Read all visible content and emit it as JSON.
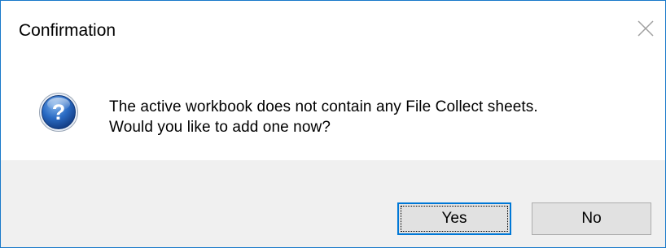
{
  "dialog": {
    "title": "Confirmation",
    "close_icon": "close-icon"
  },
  "content": {
    "icon": "question-icon",
    "message_line1": "The active workbook does not contain any File Collect sheets.",
    "message_line2": "Would you like to add one now?"
  },
  "buttons": {
    "yes_label": "Yes",
    "no_label": "No"
  },
  "colors": {
    "accent": "#0078d7",
    "window_border": "#1979ca",
    "footer_bg": "#f0f0f0",
    "button_bg": "#e1e1e1",
    "icon_blue": "#1f5fb0"
  }
}
